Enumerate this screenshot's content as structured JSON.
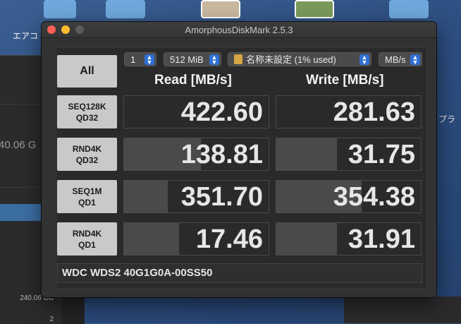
{
  "desktop": {
    "icon_label_left": "エアコ",
    "right_text": "プラ",
    "bg_capacity": "40.06 G",
    "bg_small_1": "240.06 GB",
    "bg_small_2": "2"
  },
  "window": {
    "title": "AmorphousDiskMark 2.5.3"
  },
  "controls": {
    "all_label": "All",
    "count": "1",
    "size": "512 MiB",
    "volume": "名称未設定 (1% used)",
    "unit": "MB/s"
  },
  "headers": {
    "read": "Read [MB/s]",
    "write": "Write [MB/s]"
  },
  "rows": [
    {
      "line1": "SEQ128K",
      "line2": "QD32",
      "read": "422.60",
      "write": "281.63",
      "read_fill": 0.0,
      "write_fill": 0.0
    },
    {
      "line1": "RND4K",
      "line2": "QD32",
      "read": "138.81",
      "write": "31.75",
      "read_fill": 0.53,
      "write_fill": 0.42
    },
    {
      "line1": "SEQ1M",
      "line2": "QD1",
      "read": "351.70",
      "write": "354.38",
      "read_fill": 0.3,
      "write_fill": 0.59
    },
    {
      "line1": "RND4K",
      "line2": "QD1",
      "read": "17.46",
      "write": "31.91",
      "read_fill": 0.38,
      "write_fill": 0.42
    }
  ],
  "disk": {
    "name": "WDC WDS2 40G1G0A-00SS50"
  },
  "colors": {
    "close": "#fe5f57",
    "minimize": "#febc2e",
    "select_accent": "#2f6fd6"
  }
}
